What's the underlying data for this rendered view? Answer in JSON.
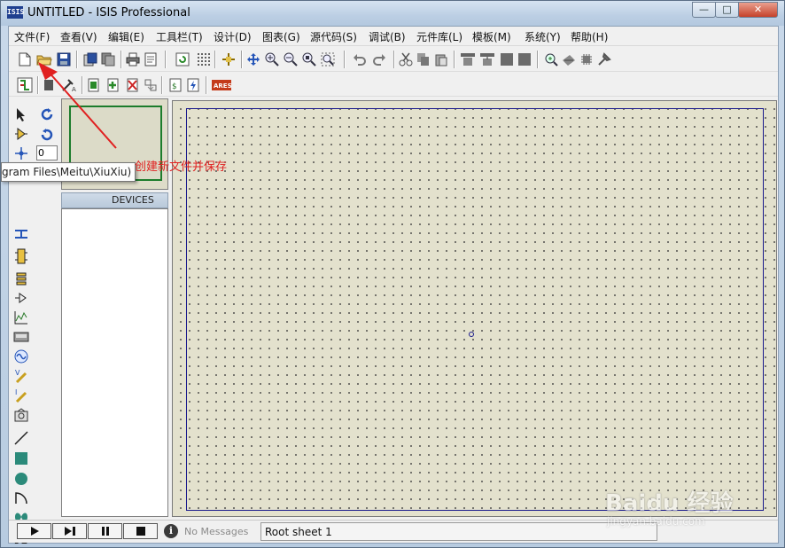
{
  "window": {
    "title": "UNTITLED - ISIS Professional",
    "app_icon_text": "ISIS",
    "caption_min": "—",
    "caption_max": "□",
    "caption_close": "✕"
  },
  "menu": [
    "文件(F)",
    "查看(V)",
    "编辑(E)",
    "工具栏(T)",
    "设计(D)",
    "图表(G)",
    "源代码(S)",
    "调试(B)",
    "元件库(L)",
    "模板(M)",
    "系统(Y)",
    "帮助(H)"
  ],
  "toolbar_icons": {
    "row1": [
      "new-file-icon",
      "open-folder-icon",
      "save-icon",
      "import-icon",
      "export-icon",
      "print-icon",
      "page-setup-icon",
      "refresh-icon",
      "grid-icon",
      "origin-icon",
      "pan-icon",
      "zoom-in-icon",
      "zoom-out-icon",
      "zoom-all-icon",
      "zoom-area-icon",
      "undo-icon",
      "redo-icon",
      "cut-icon",
      "copy-icon",
      "paste-icon",
      "block-copy-icon",
      "block-move-icon",
      "block-rotate-icon",
      "block-delete-icon",
      "pick-device-icon",
      "make-device-icon",
      "package-tool-icon",
      "decompose-icon"
    ],
    "row2": [
      "wire-autorouter-icon",
      "search-select-icon",
      "property-tool-icon",
      "new-sheet-icon",
      "add-sheet-icon",
      "remove-sheet-icon",
      "goto-sheet-icon",
      "bom-icon",
      "electrical-rules-icon",
      "ares-netlist-icon"
    ]
  },
  "ares_label": "ARES",
  "left_tools": [
    "select-arrow-icon",
    "component-icon",
    "junction-icon",
    "wire-label-icon",
    "text-script-icon",
    "bus-icon",
    "subcircuit-icon",
    "terminal-icon",
    "device-pin-icon",
    "graph-icon",
    "tape-recorder-icon",
    "generator-icon",
    "voltage-probe-icon",
    "current-probe-icon",
    "virtual-instrument-icon",
    "line-icon",
    "box-icon",
    "circle-icon",
    "arc-icon",
    "path-icon",
    "text-icon"
  ],
  "rotation": {
    "value": "0"
  },
  "panel": {
    "devices_header": "DEVICES",
    "tooltip": "gram Files\\Meitu\\XiuXiu)"
  },
  "annotation": {
    "text": "创建新文件并保存",
    "color": "#e02020"
  },
  "status": {
    "messages": "No Messages",
    "sheet": "Root sheet 1"
  },
  "watermark": {
    "brand": "Bai",
    "brand2": "du 经验",
    "url": "jingyan.baidu.com"
  },
  "colors": {
    "sheet_border": "#1a1a8c",
    "canvas_bg": "#e3e1cd",
    "overview_frame": "#1c7c2c"
  }
}
